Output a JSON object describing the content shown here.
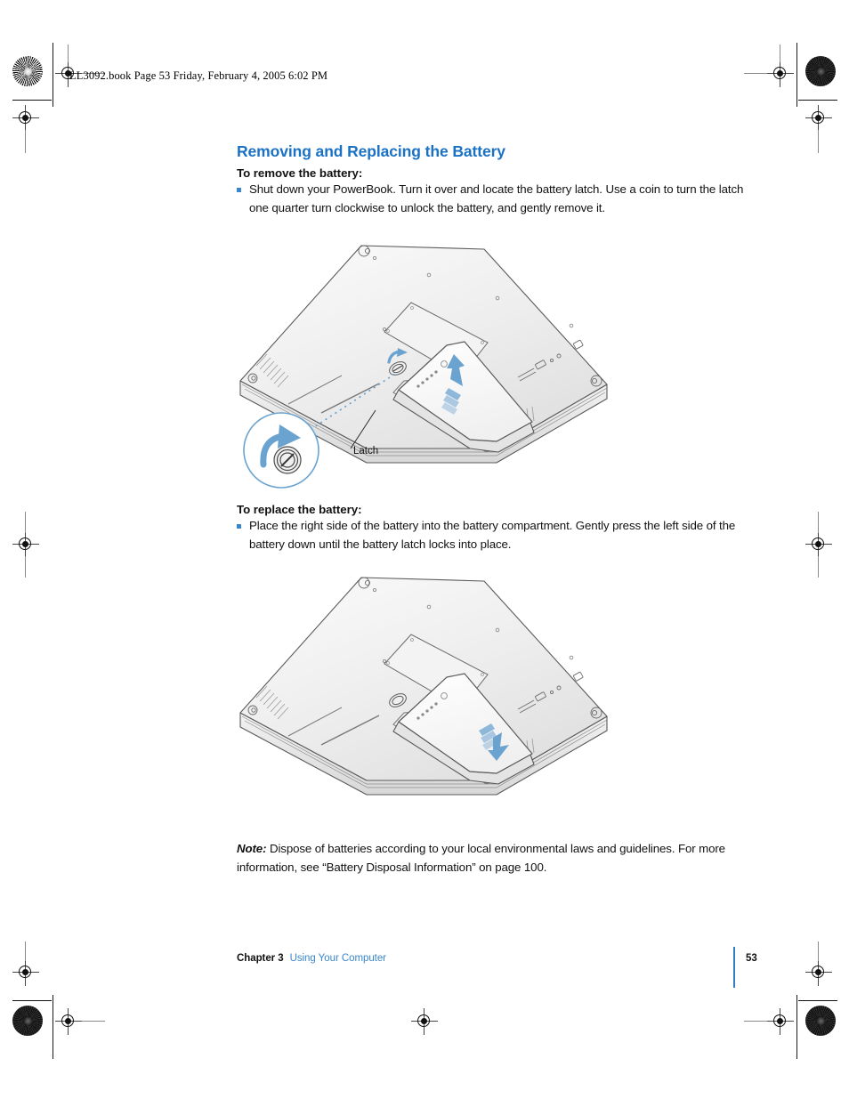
{
  "document": {
    "header_stamp": "LL3092.book  Page 53  Friday, February 4, 2005  6:02 PM",
    "page_number": "53"
  },
  "section": {
    "title": "Removing and Replacing the Battery"
  },
  "remove": {
    "subhead": "To remove the battery:",
    "bullet": "Shut down your PowerBook. Turn it over and locate the battery latch. Use a coin to turn the latch one quarter turn clockwise to unlock the battery, and gently remove it."
  },
  "replace": {
    "subhead": "To replace the battery:",
    "bullet": "Place the right side of the battery into the battery compartment. Gently press the left side of the battery down until the battery latch locks into place."
  },
  "figure_remove": {
    "alt": "PowerBook bottom view with battery being lifted out and latch callout",
    "callout_label": "Latch"
  },
  "figure_replace": {
    "alt": "PowerBook bottom view with battery being pressed into the compartment"
  },
  "note": {
    "lead": "Note:",
    "text": "Dispose of batteries according to your local environmental laws and guidelines. For more information, see “Battery Disposal Information” on page 100."
  },
  "footer": {
    "chapter": "Chapter 3",
    "chapter_title": "Using Your Computer"
  },
  "colors": {
    "heading_blue": "#1b72c4",
    "link_blue": "#3a86cc",
    "arrow_blue": "#6ba3d0",
    "rule_blue": "#2f7dc4",
    "text_black": "#111111"
  }
}
